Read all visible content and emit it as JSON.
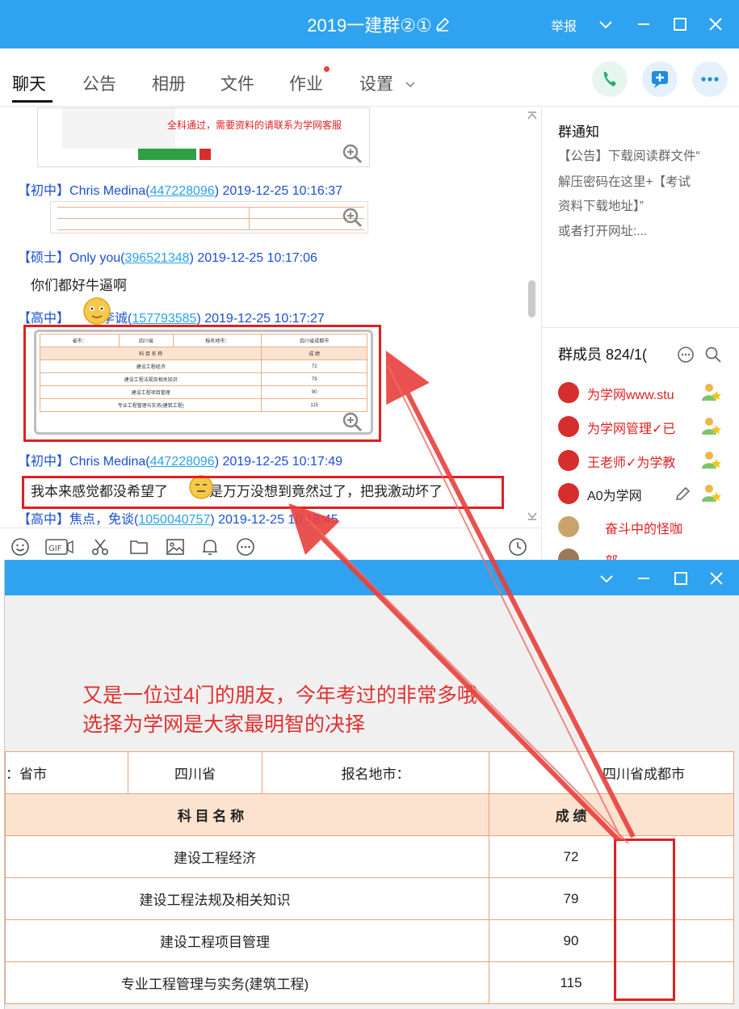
{
  "window": {
    "title": "2019一建群②①",
    "report_label": "举报"
  },
  "tabs": [
    {
      "label": "聊天"
    },
    {
      "label": "公告"
    },
    {
      "label": "相册"
    },
    {
      "label": "文件"
    },
    {
      "label": "作业"
    },
    {
      "label": "设置"
    }
  ],
  "chat": {
    "first_image_caption": "全科通过，需要资料的请联系为学网客服",
    "messages": [
      {
        "level": "【初中】",
        "name": "Chris Medina",
        "qq": "447228096",
        "time": "2019-12-25 10:16:37"
      },
      {
        "level": "【硕士】",
        "name": "Only you",
        "qq": "396521348",
        "time": "2019-12-25 10:17:06",
        "text": "你们都好牛逼啊"
      },
      {
        "level": "【高中】",
        "name": "李诚",
        "qq": "157793585",
        "time": "2019-12-25 10:17:27"
      },
      {
        "level": "【初中】",
        "name": "Chris Medina",
        "qq": "447228096",
        "time": "2019-12-25 10:17:49",
        "text_a": "我本来感觉都没希望了",
        "text_b": "真是万万没想到竟然过了，把我激动坏了"
      },
      {
        "level": "【高中】",
        "name": "焦点，免谈",
        "qq": "1050040757",
        "time": "2019-12-25 10:18:45"
      }
    ]
  },
  "notice": {
    "title": "群通知",
    "lines": [
      "【公告】下载阅读群文件“",
      "解压密码在这里+【考试",
      "资料下载地址】”",
      "或者打开网址:..."
    ]
  },
  "members": {
    "title": "群成员 824/1(",
    "list": [
      {
        "name": "为学网www.stu"
      },
      {
        "name": "为学网管理✓已"
      },
      {
        "name": "王老师✓为学教"
      },
      {
        "name": "A0为学网"
      },
      {
        "name": "奋斗中的怪咖"
      },
      {
        "name": "部"
      }
    ]
  },
  "viewer": {
    "caption_line1": "又是一位过4门的朋友，今年考过的非常多哦",
    "caption_line2": "选择为学网是大家最明智的决择",
    "table": {
      "province_label": "省市：",
      "province_value": "四川省",
      "city_label": "报名地市：",
      "city_value": "四川省成都市",
      "header_subject": "科  目  名  称",
      "header_score": "成  绩",
      "rows": [
        {
          "subject": "建设工程经济",
          "score": "72"
        },
        {
          "subject": "建设工程法规及相关知识",
          "score": "79"
        },
        {
          "subject": "建设工程项目管理",
          "score": "90"
        },
        {
          "subject": "专业工程管理与实务(建筑工程)",
          "score": "115"
        }
      ]
    }
  },
  "colors": {
    "accent": "#2fa3f0",
    "annotation": "#e02020",
    "qq_link": "#2aa3e6",
    "name_blue": "#1a4fd4"
  }
}
